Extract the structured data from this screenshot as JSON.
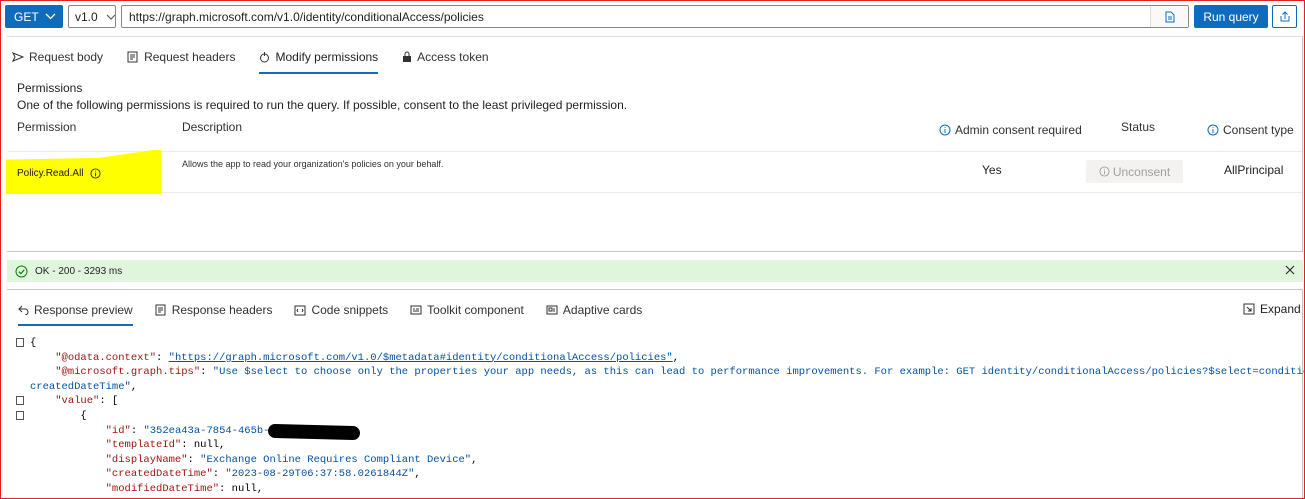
{
  "toolbar": {
    "method": "GET",
    "version": "v1.0",
    "url": "https://graph.microsoft.com/v1.0/identity/conditionalAccess/policies",
    "run_label": "Run query"
  },
  "request_tabs": [
    {
      "label": "Request body",
      "icon": "send-icon"
    },
    {
      "label": "Request headers",
      "icon": "headers-icon"
    },
    {
      "label": "Modify permissions",
      "icon": "permissions-icon",
      "active": true
    },
    {
      "label": "Access token",
      "icon": "lock-icon"
    }
  ],
  "permissions": {
    "title": "Permissions",
    "subtitle": "One of the following permissions is required to run the query. If possible, consent to the least privileged permission.",
    "columns": {
      "permission": "Permission",
      "description": "Description",
      "admin_consent": "Admin consent required",
      "status": "Status",
      "consent_type": "Consent type"
    },
    "rows": [
      {
        "name": "Policy.Read.All",
        "description": "Allows the app to read your organization's policies on your behalf.",
        "admin_consent": "Yes",
        "status_button": "Unconsent",
        "consent_type": "AllPrincipal"
      }
    ]
  },
  "status_bar": {
    "text": "OK - 200 - 3293 ms",
    "color": "#dff6dd"
  },
  "response_tabs": [
    {
      "label": "Response preview",
      "icon": "back-arrow-icon",
      "active": true
    },
    {
      "label": "Response headers",
      "icon": "headers-icon"
    },
    {
      "label": "Code snippets",
      "icon": "code-icon"
    },
    {
      "label": "Toolkit component",
      "icon": "toolkit-icon"
    },
    {
      "label": "Adaptive cards",
      "icon": "card-icon"
    }
  ],
  "expand_label": "Expand",
  "response_lines": [
    {
      "fold": true,
      "parts": [
        {
          "t": "{",
          "c": "p"
        }
      ]
    },
    {
      "fold": false,
      "parts": [
        {
          "t": "    ",
          "c": "p"
        },
        {
          "t": "\"@odata.context\"",
          "c": "k"
        },
        {
          "t": ": ",
          "c": "p"
        },
        {
          "t": "\"https://graph.microsoft.com/v1.0/$metadata#identity/conditionalAccess/policies\"",
          "c": "s u"
        },
        {
          "t": ",",
          "c": "p"
        }
      ]
    },
    {
      "fold": false,
      "parts": [
        {
          "t": "    ",
          "c": "p"
        },
        {
          "t": "\"@microsoft.graph.tips\"",
          "c": "k"
        },
        {
          "t": ": ",
          "c": "p"
        },
        {
          "t": "\"Use $select to choose only the properties your app needs, as this can lead to performance improvements. For example: GET identity/conditionalAccess/policies?$select=conditions,",
          "c": "s"
        }
      ]
    },
    {
      "fold": false,
      "parts": [
        {
          "t": "createdDateTime\"",
          "c": "s"
        },
        {
          "t": ",",
          "c": "p"
        }
      ]
    },
    {
      "fold": true,
      "parts": [
        {
          "t": "    ",
          "c": "p"
        },
        {
          "t": "\"value\"",
          "c": "k"
        },
        {
          "t": ": [",
          "c": "p"
        }
      ]
    },
    {
      "fold": true,
      "parts": [
        {
          "t": "        {",
          "c": "p"
        }
      ]
    },
    {
      "fold": false,
      "parts": [
        {
          "t": "            ",
          "c": "p"
        },
        {
          "t": "\"id\"",
          "c": "k"
        },
        {
          "t": ": ",
          "c": "p"
        },
        {
          "t": "\"352ea43a-7854-465b-869",
          "c": "s"
        }
      ]
    },
    {
      "fold": false,
      "parts": [
        {
          "t": "            ",
          "c": "p"
        },
        {
          "t": "\"templateId\"",
          "c": "k"
        },
        {
          "t": ": null,",
          "c": "p"
        }
      ]
    },
    {
      "fold": false,
      "parts": [
        {
          "t": "            ",
          "c": "p"
        },
        {
          "t": "\"displayName\"",
          "c": "k"
        },
        {
          "t": ": ",
          "c": "p"
        },
        {
          "t": "\"Exchange Online Requires Compliant Device\"",
          "c": "s"
        },
        {
          "t": ",",
          "c": "p"
        }
      ]
    },
    {
      "fold": false,
      "parts": [
        {
          "t": "            ",
          "c": "p"
        },
        {
          "t": "\"createdDateTime\"",
          "c": "k"
        },
        {
          "t": ": ",
          "c": "p"
        },
        {
          "t": "\"2023-08-29T06:37:58.0261844Z\"",
          "c": "s"
        },
        {
          "t": ",",
          "c": "p"
        }
      ]
    },
    {
      "fold": false,
      "parts": [
        {
          "t": "            ",
          "c": "p"
        },
        {
          "t": "\"modifiedDateTime\"",
          "c": "k"
        },
        {
          "t": ": null,",
          "c": "p"
        }
      ]
    }
  ]
}
